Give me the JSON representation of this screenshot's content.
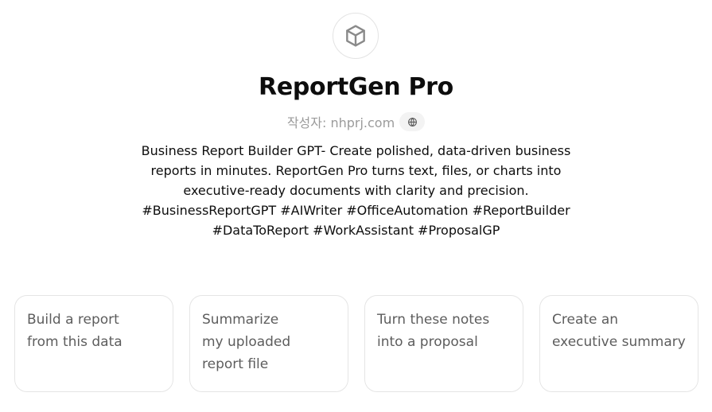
{
  "gpt": {
    "avatar_icon": "cube-icon",
    "name": "ReportGen Pro",
    "author": "작성자: nhprj.com",
    "website_icon": "globe-icon",
    "description": "Business Report Builder GPT- Create polished, data-driven business\nreports in minutes. ReportGen Pro turns text, files, or charts into\nexecutive-ready documents with clarity and precision.\n#BusinessReportGPT #AIWriter #OfficeAutomation #ReportBuilder\n#DataToReport #WorkAssistant #ProposalGP"
  },
  "conversation_starters": [
    {
      "label": "Build a report\nfrom this data"
    },
    {
      "label": "Summarize\nmy uploaded\nreport file"
    },
    {
      "label": "Turn these notes\ninto a proposal"
    },
    {
      "label": "Create an\nexecutive summary"
    }
  ],
  "colors": {
    "title": "#0d0d0d",
    "muted": "#9b9b9b",
    "card_border": "#e5e5e5",
    "card_text": "#5d5d5d"
  }
}
